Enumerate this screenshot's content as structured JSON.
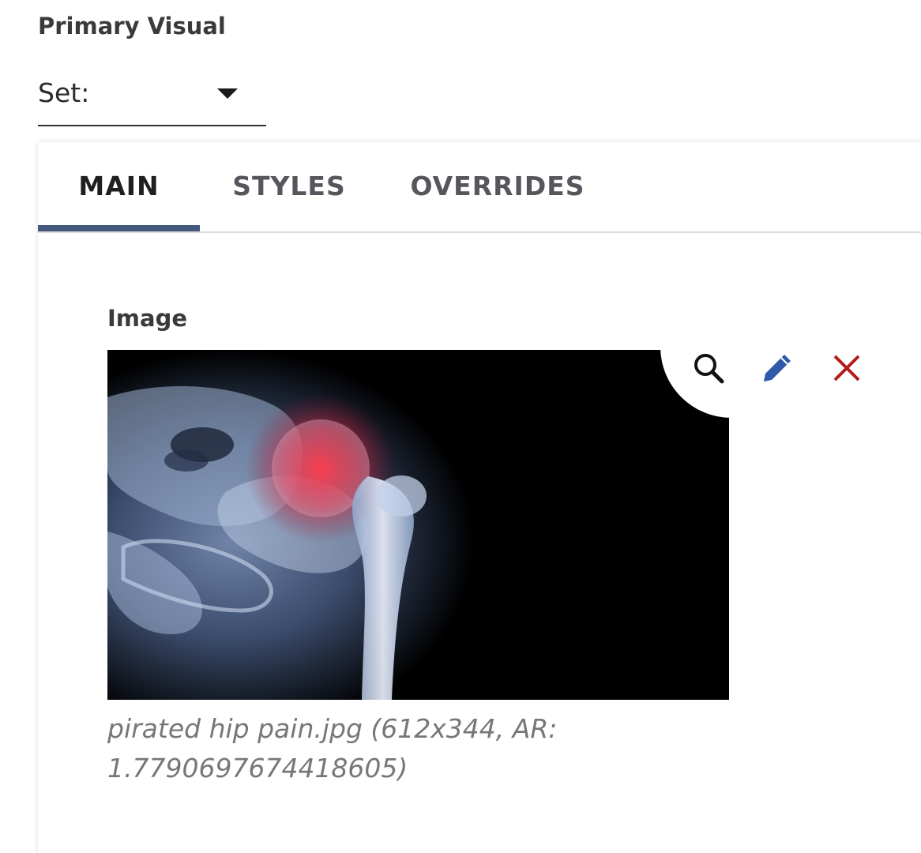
{
  "section": {
    "title": "Primary Visual"
  },
  "set_select": {
    "label": "Set:",
    "selected": ""
  },
  "tabs": [
    {
      "label": "MAIN",
      "active": true
    },
    {
      "label": "STYLES",
      "active": false
    },
    {
      "label": "OVERRIDES",
      "active": false
    }
  ],
  "image_field": {
    "label": "Image",
    "caption": "pirated hip pain.jpg (612x344, AR: 1.7790697674418605)",
    "actions": {
      "search_icon": "search-icon",
      "edit_icon": "pencil-icon",
      "remove_icon": "close-icon"
    }
  },
  "colors": {
    "tab_underline": "#45587d",
    "edit_icon": "#2f5aa8",
    "remove_icon": "#b31b1b"
  }
}
